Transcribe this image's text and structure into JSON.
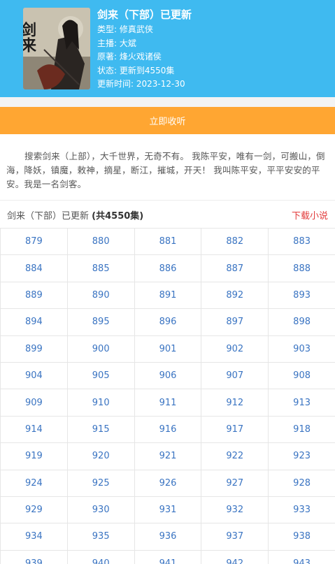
{
  "book": {
    "title": "剑来（下部）已更新",
    "type_row": "类型: 修真武侠",
    "host_row": "主播: 大斌",
    "author_row": "原著: 烽火戏诸侯",
    "status_row": "状态: 更新到4550集",
    "updated_row": "更新时间: 2023-12-30",
    "cover_icon": "book-cover-image",
    "cover_text": "剑来"
  },
  "actions": {
    "listen_label": "立即收听"
  },
  "description": "搜索剑来（上部），大千世界，无奇不有。 我陈平安，唯有一剑，可搬山，倒海，降妖，镇魔，敕神，摘星，断江，摧城，开天！ 我叫陈平安，平平安安的平安。我是一名剑客。",
  "episode_list": {
    "heading_prefix": "剑来（下部）已更新",
    "heading_count": "(共4550集)",
    "download_label": "下载小说",
    "episodes": [
      "879",
      "880",
      "881",
      "882",
      "883",
      "884",
      "885",
      "886",
      "887",
      "888",
      "889",
      "890",
      "891",
      "892",
      "893",
      "894",
      "895",
      "896",
      "897",
      "898",
      "899",
      "900",
      "901",
      "902",
      "903",
      "904",
      "905",
      "906",
      "907",
      "908",
      "909",
      "910",
      "911",
      "912",
      "913",
      "914",
      "915",
      "916",
      "917",
      "918",
      "919",
      "920",
      "921",
      "922",
      "923",
      "924",
      "925",
      "926",
      "927",
      "928",
      "929",
      "930",
      "931",
      "932",
      "933",
      "934",
      "935",
      "936",
      "937",
      "938",
      "939",
      "940",
      "941",
      "942",
      "943"
    ]
  },
  "colors": {
    "header_bg": "#3fbaf0",
    "listen_button_bg": "#ffa632",
    "download_link": "#e23b3b",
    "episode_link": "#3a74c2"
  }
}
